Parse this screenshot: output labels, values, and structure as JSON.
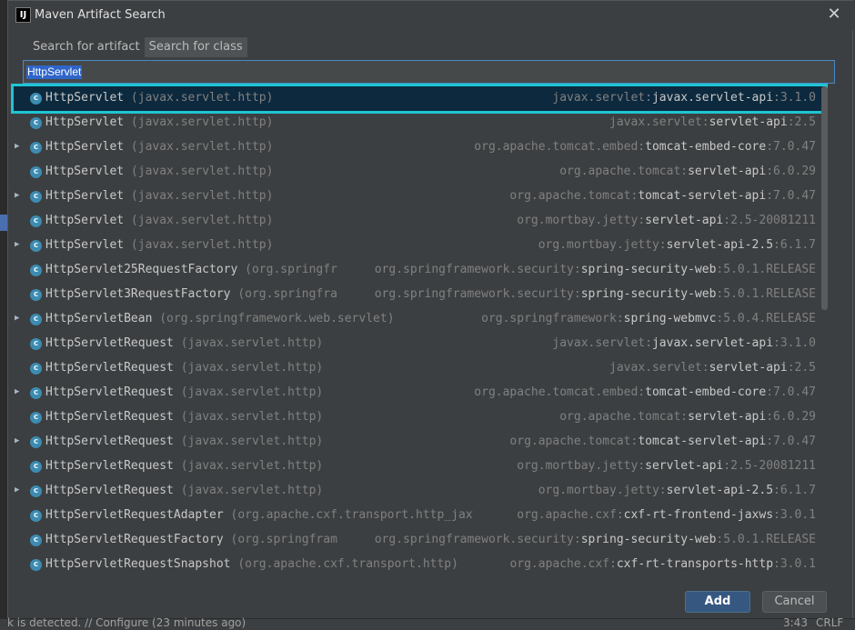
{
  "dialog": {
    "title": "Maven Artifact Search",
    "app_icon_text": "IJ",
    "close_symbol": "✕"
  },
  "tabs": [
    {
      "label": "Search for artifact",
      "active": true
    },
    {
      "label": "Search for class",
      "active": false
    }
  ],
  "search": {
    "value": "HttpServlet"
  },
  "results": [
    {
      "expandable": false,
      "cls": "HttpServlet",
      "pkg": "(javax.servlet.http)",
      "group": "javax.servlet:",
      "artifact": "javax.servlet-api",
      "version": ":3.1.0",
      "selected": true
    },
    {
      "expandable": false,
      "cls": "HttpServlet",
      "pkg": "(javax.servlet.http)",
      "group": "javax.servlet:",
      "artifact": "servlet-api",
      "version": ":2.5"
    },
    {
      "expandable": true,
      "cls": "HttpServlet",
      "pkg": "(javax.servlet.http)",
      "group": "org.apache.tomcat.embed:",
      "artifact": "tomcat-embed-core",
      "version": ":7.0.47"
    },
    {
      "expandable": false,
      "cls": "HttpServlet",
      "pkg": "(javax.servlet.http)",
      "group": "org.apache.tomcat:",
      "artifact": "servlet-api",
      "version": ":6.0.29"
    },
    {
      "expandable": true,
      "cls": "HttpServlet",
      "pkg": "(javax.servlet.http)",
      "group": "org.apache.tomcat:",
      "artifact": "tomcat-servlet-api",
      "version": ":7.0.47"
    },
    {
      "expandable": false,
      "cls": "HttpServlet",
      "pkg": "(javax.servlet.http)",
      "group": "org.mortbay.jetty:",
      "artifact": "servlet-api",
      "version": ":2.5-20081211"
    },
    {
      "expandable": true,
      "cls": "HttpServlet",
      "pkg": "(javax.servlet.http)",
      "group": "org.mortbay.jetty:",
      "artifact": "servlet-api-2.5",
      "version": ":6.1.7"
    },
    {
      "expandable": false,
      "cls": "HttpServlet25RequestFactory",
      "pkg": "(org.springfr",
      "group": "org.springframework.security:",
      "artifact": "spring-security-web",
      "version": ":5.0.1.RELEASE"
    },
    {
      "expandable": false,
      "cls": "HttpServlet3RequestFactory",
      "pkg": "(org.springfra",
      "group": "org.springframework.security:",
      "artifact": "spring-security-web",
      "version": ":5.0.1.RELEASE"
    },
    {
      "expandable": true,
      "cls": "HttpServletBean",
      "pkg": "(org.springframework.web.servlet)",
      "group": "org.springframework:",
      "artifact": "spring-webmvc",
      "version": ":5.0.4.RELEASE"
    },
    {
      "expandable": false,
      "cls": "HttpServletRequest",
      "pkg": "(javax.servlet.http)",
      "group": "javax.servlet:",
      "artifact": "javax.servlet-api",
      "version": ":3.1.0"
    },
    {
      "expandable": false,
      "cls": "HttpServletRequest",
      "pkg": "(javax.servlet.http)",
      "group": "javax.servlet:",
      "artifact": "servlet-api",
      "version": ":2.5"
    },
    {
      "expandable": true,
      "cls": "HttpServletRequest",
      "pkg": "(javax.servlet.http)",
      "group": "org.apache.tomcat.embed:",
      "artifact": "tomcat-embed-core",
      "version": ":7.0.47"
    },
    {
      "expandable": false,
      "cls": "HttpServletRequest",
      "pkg": "(javax.servlet.http)",
      "group": "org.apache.tomcat:",
      "artifact": "servlet-api",
      "version": ":6.0.29"
    },
    {
      "expandable": true,
      "cls": "HttpServletRequest",
      "pkg": "(javax.servlet.http)",
      "group": "org.apache.tomcat:",
      "artifact": "tomcat-servlet-api",
      "version": ":7.0.47"
    },
    {
      "expandable": false,
      "cls": "HttpServletRequest",
      "pkg": "(javax.servlet.http)",
      "group": "org.mortbay.jetty:",
      "artifact": "servlet-api",
      "version": ":2.5-20081211"
    },
    {
      "expandable": true,
      "cls": "HttpServletRequest",
      "pkg": "(javax.servlet.http)",
      "group": "org.mortbay.jetty:",
      "artifact": "servlet-api-2.5",
      "version": ":6.1.7"
    },
    {
      "expandable": false,
      "cls": "HttpServletRequestAdapter",
      "pkg": "(org.apache.cxf.transport.http_jaxw",
      "group": "org.apache.cxf:",
      "artifact": "cxf-rt-frontend-jaxws",
      "version": ":3.0.1"
    },
    {
      "expandable": false,
      "cls": "HttpServletRequestFactory",
      "pkg": "(org.springfram",
      "group": "org.springframework.security:",
      "artifact": "spring-security-web",
      "version": ":5.0.1.RELEASE"
    },
    {
      "expandable": false,
      "cls": "HttpServletRequestSnapshot",
      "pkg": "(org.apache.cxf.transport.http)",
      "group": "org.apache.cxf:",
      "artifact": "cxf-rt-transports-http",
      "version": ":3.0.1"
    }
  ],
  "buttons": {
    "add": "Add",
    "cancel": "Cancel"
  },
  "status_bar": {
    "message": "k is detected. // Configure (23 minutes ago)",
    "time": "3:43",
    "line_sep": "CRLF ÷"
  },
  "colors": {
    "selection_frame": "#1fc5d2",
    "selected_row": "#0d293e",
    "class_icon": "#3d8bb0",
    "add_button": "#365880"
  }
}
